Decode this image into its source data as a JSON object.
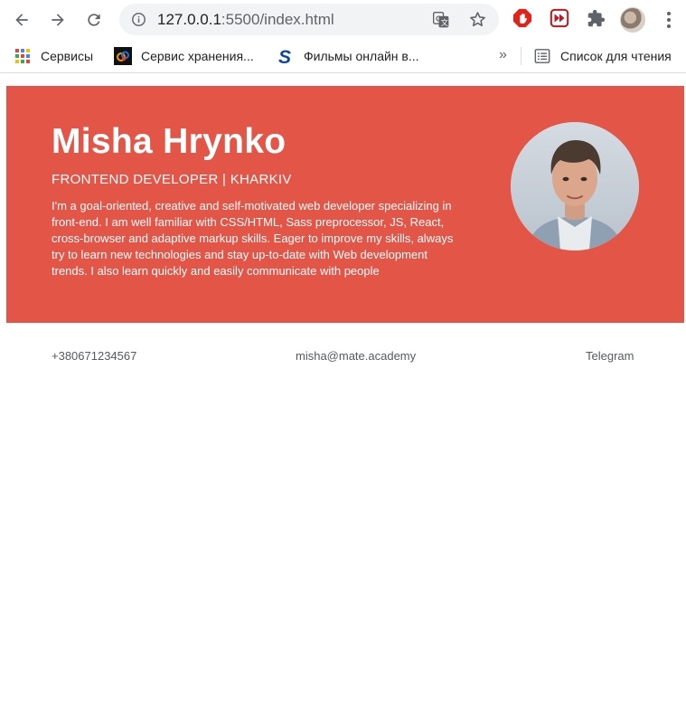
{
  "browser": {
    "url_host": "127.0.0.1",
    "url_rest": ":5500/index.html",
    "bookmarks": [
      {
        "label": "Сервисы",
        "icon": "apps-grid-icon"
      },
      {
        "label": "Сервис хранения...",
        "icon": "cloud-storage-icon"
      },
      {
        "label": "Фильмы онлайн в...",
        "icon": "s-logo-icon"
      }
    ],
    "more_bookmarks": "»",
    "reading_list_label": "Список для чтения",
    "accent_colors": {
      "adblock": "#e2231a",
      "ext_red": "#c4161c"
    }
  },
  "hero": {
    "name": "Misha Hrynko",
    "role": "FRONTEND DEVELOPER | KHARKIV",
    "bio": "I'm a goal-oriented, creative and self-motivated web developer specializing in front-end. I am well familiar with CSS/HTML, Sass preprocessor, JS, React, cross-browser and adaptive markup skills. Eager to improve my skills, always try to learn new technologies and stay up-to-date with Web development trends. I also learn quickly and easily communicate with people",
    "background_color": "#e25547"
  },
  "contacts": {
    "phone": "+380671234567",
    "email": "misha@mate.academy",
    "telegram": "Telegram"
  }
}
